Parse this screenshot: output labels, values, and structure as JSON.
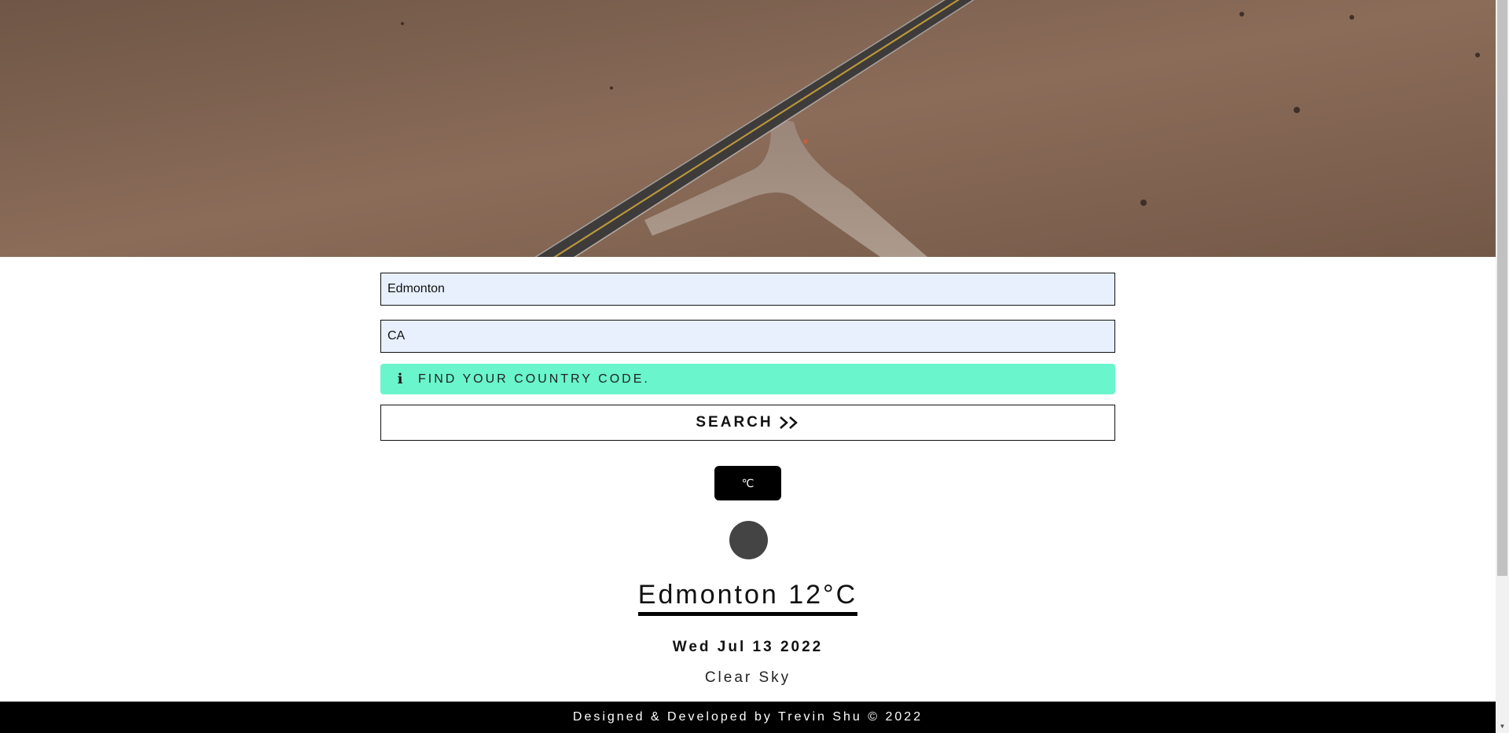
{
  "hero": {
    "image": "desert-road-aerial"
  },
  "form": {
    "city_value": "Edmonton",
    "country_value": "CA",
    "notice_icon": "info-icon",
    "notice_text": "Find your country code.",
    "search_label": "SEARCH",
    "search_icon": "double-chevron-right-icon"
  },
  "unit_toggle": {
    "label": "℃"
  },
  "weather": {
    "icon": "weather-icon",
    "title": "Edmonton 12°C",
    "date": "Wed Jul 13 2022",
    "description": "Clear Sky"
  },
  "footer": {
    "text": "Designed & Developed by Trevin Shu © 2022"
  },
  "colors": {
    "notice_bg": "#6af5cc",
    "input_bg": "#e8f0fe",
    "footer_bg": "#000000",
    "unit_button_bg": "#000000"
  }
}
